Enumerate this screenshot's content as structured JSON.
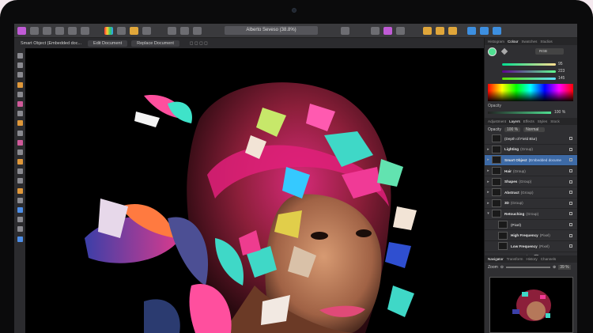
{
  "toolbar": {
    "document_title": "Alberto Seveso (38.8%)"
  },
  "context": {
    "label": "Smart Object (Embedded doc...",
    "edit_btn": "Edit Document",
    "replace_btn": "Replace Document"
  },
  "panel": {
    "top_tabs": [
      "Histogram",
      "Colour",
      "Swatches",
      "Studios"
    ],
    "colour_mode": "RGB",
    "rgb_values": [
      "95",
      "223",
      "145"
    ],
    "opacity_label": "Opacity",
    "opacity_value": "100 %",
    "mid_tabs": [
      "Adjustment",
      "Layers",
      "Effects",
      "Styles",
      "Stock"
    ],
    "layers_opacity_label": "Opacity",
    "layers_opacity_value": "100 %",
    "blend_mode": "Normal",
    "layers": [
      {
        "name": "(Depth of Field Blur)",
        "kind": ""
      },
      {
        "name": "Lighting",
        "kind": "(Group)"
      },
      {
        "name": "Smart Object",
        "kind": "(Embedded docume"
      },
      {
        "name": "Hair",
        "kind": "(Group)"
      },
      {
        "name": "Shapes",
        "kind": "(Group)"
      },
      {
        "name": "Abstract",
        "kind": "(Group)"
      },
      {
        "name": "3D",
        "kind": "(Group)"
      },
      {
        "name": "Retouching",
        "kind": "(Group)"
      },
      {
        "name": "(Pixel)",
        "kind": ""
      },
      {
        "name": "High Frequency",
        "kind": "(Pixel)"
      },
      {
        "name": "Low Frequency",
        "kind": "(Pixel)"
      }
    ],
    "nav_tabs": [
      "Navigator",
      "Transform",
      "History",
      "Channels"
    ],
    "zoom_label": "Zoom",
    "zoom_value": "39 %"
  },
  "colors": {
    "accent": "#3d6aa6",
    "fill_colour": "#4fdf91"
  },
  "selected_layer": "Smart Object"
}
